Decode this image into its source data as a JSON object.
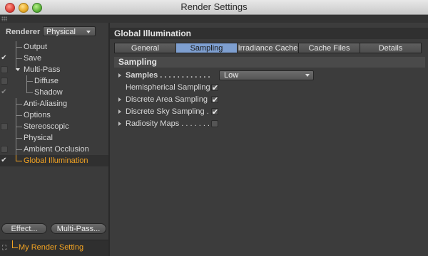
{
  "window": {
    "title": "Render Settings"
  },
  "left": {
    "renderer_label": "Renderer",
    "renderer_value": "Physical",
    "tree": [
      {
        "label": "Output",
        "check": "none",
        "depth": 0
      },
      {
        "label": "Save",
        "check": "tick",
        "depth": 0
      },
      {
        "label": "Multi-Pass",
        "check": "box",
        "depth": 0,
        "expanded": true
      },
      {
        "label": "Diffuse",
        "check": "box",
        "depth": 1
      },
      {
        "label": "Shadow",
        "check": "tick-dim",
        "depth": 1
      },
      {
        "label": "Anti-Aliasing",
        "check": "none",
        "depth": 0
      },
      {
        "label": "Options",
        "check": "none",
        "depth": 0
      },
      {
        "label": "Stereoscopic",
        "check": "box",
        "depth": 0
      },
      {
        "label": "Physical",
        "check": "none",
        "depth": 0
      },
      {
        "label": "Ambient Occlusion",
        "check": "box",
        "depth": 0
      },
      {
        "label": "Global Illumination",
        "check": "tick",
        "depth": 0,
        "selected": true
      }
    ],
    "effect_button": "Effect...",
    "multipass_button": "Multi-Pass...",
    "render_setting": "My Render Setting"
  },
  "right": {
    "section_title": "Global Illumination",
    "tabs": [
      "General",
      "Sampling",
      "Irradiance Cache",
      "Cache Files",
      "Details"
    ],
    "active_tab": "Sampling",
    "group_title": "Sampling",
    "props": {
      "samples_label": "Samples . . . . . . . . . . . .",
      "samples_value": "Low",
      "hemispherical_label": "Hemispherical Sampling",
      "hemispherical_checked": true,
      "discrete_area_label": "Discrete Area Sampling",
      "discrete_area_checked": true,
      "discrete_sky_label": "Discrete Sky Sampling  .",
      "discrete_sky_checked": true,
      "radiosity_label": "Radiosity Maps . . . . . . . .",
      "radiosity_checked": false
    }
  },
  "colors": {
    "accent": "#f2a323",
    "active_tab": "#7e9fd0"
  },
  "icons": {
    "check": "✔",
    "setting": "⛶"
  }
}
